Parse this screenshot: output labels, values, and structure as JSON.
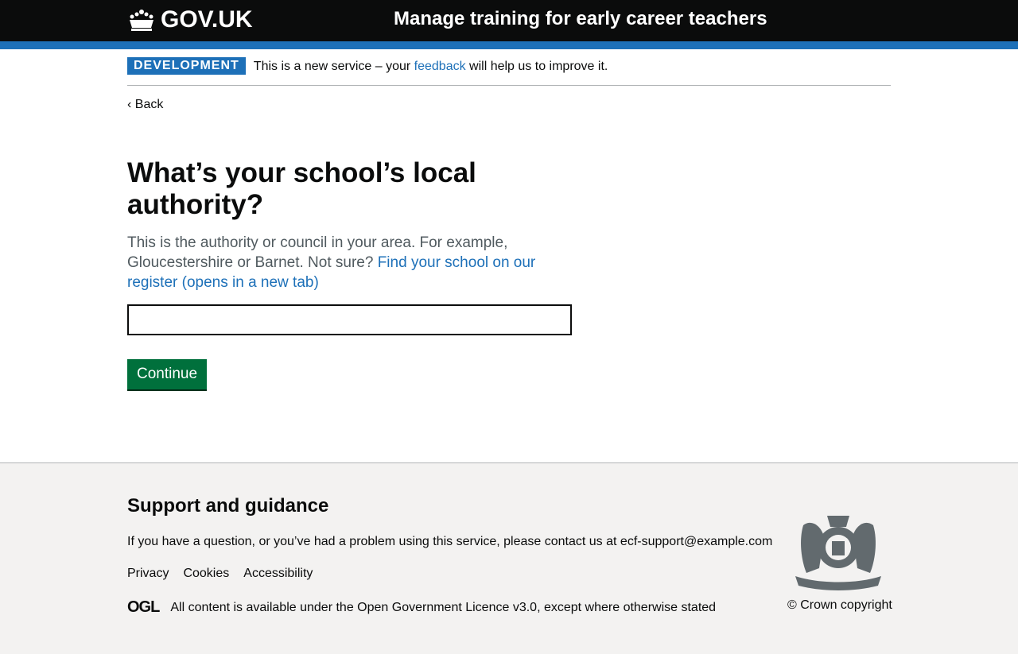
{
  "header": {
    "logo": "GOV.UK",
    "service": "Manage training for early career teachers"
  },
  "phase": {
    "tag": "DEVELOPMENT",
    "text_before": "This is a new service – your ",
    "link": "feedback",
    "text_after": " will help us to improve it."
  },
  "back": "Back",
  "main": {
    "title": "What’s your school’s local authority?",
    "hint": "This is the authority or council in your area. For example, Gloucestershire or Barnet. Not sure? ",
    "hint_link": "Find your school on our register (opens in a new tab)",
    "input_value": "",
    "button": "Continue"
  },
  "footer": {
    "heading": "Support and guidance",
    "contact": "If you have a question, or you’ve had a problem using this service, please contact us at ",
    "email": "ecf-support@example.com",
    "links": [
      "Privacy",
      "Cookies",
      "Accessibility"
    ],
    "ogl": "OGL",
    "licence_before": "All content is available under the ",
    "licence_link": "Open Government Licence v3.0",
    "licence_after": ", except where otherwise stated",
    "copyright": "© Crown copyright"
  }
}
